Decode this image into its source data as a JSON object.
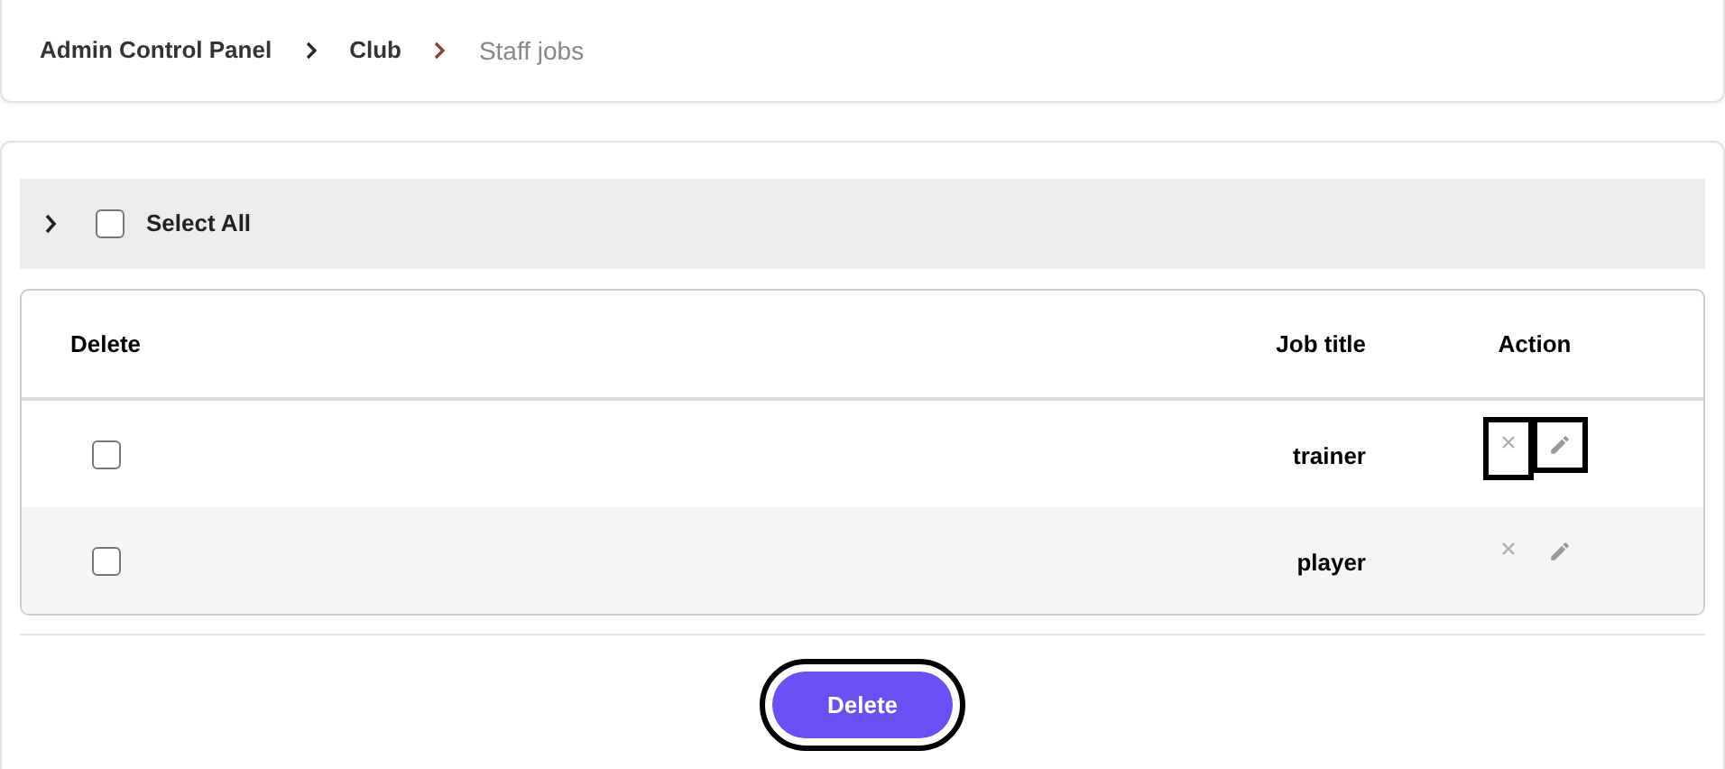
{
  "breadcrumb": [
    {
      "label": "Admin Control Panel",
      "current": false
    },
    {
      "label": "Club",
      "current": false
    },
    {
      "label": "Staff jobs",
      "current": true
    }
  ],
  "select_all": {
    "label": "Select All",
    "checked": false,
    "expanded": false
  },
  "table": {
    "columns": [
      "Delete",
      "Job title",
      "Action"
    ],
    "rows": [
      {
        "checked": false,
        "job_title": "trainer",
        "actions": [
          {
            "kind": "delete",
            "highlighted": true
          },
          {
            "kind": "edit",
            "highlighted": true
          }
        ]
      },
      {
        "checked": false,
        "job_title": "player",
        "actions": [
          {
            "kind": "delete",
            "highlighted": false
          },
          {
            "kind": "edit",
            "highlighted": false
          }
        ]
      }
    ]
  },
  "delete_button": {
    "label": "Delete",
    "highlighted": true
  }
}
